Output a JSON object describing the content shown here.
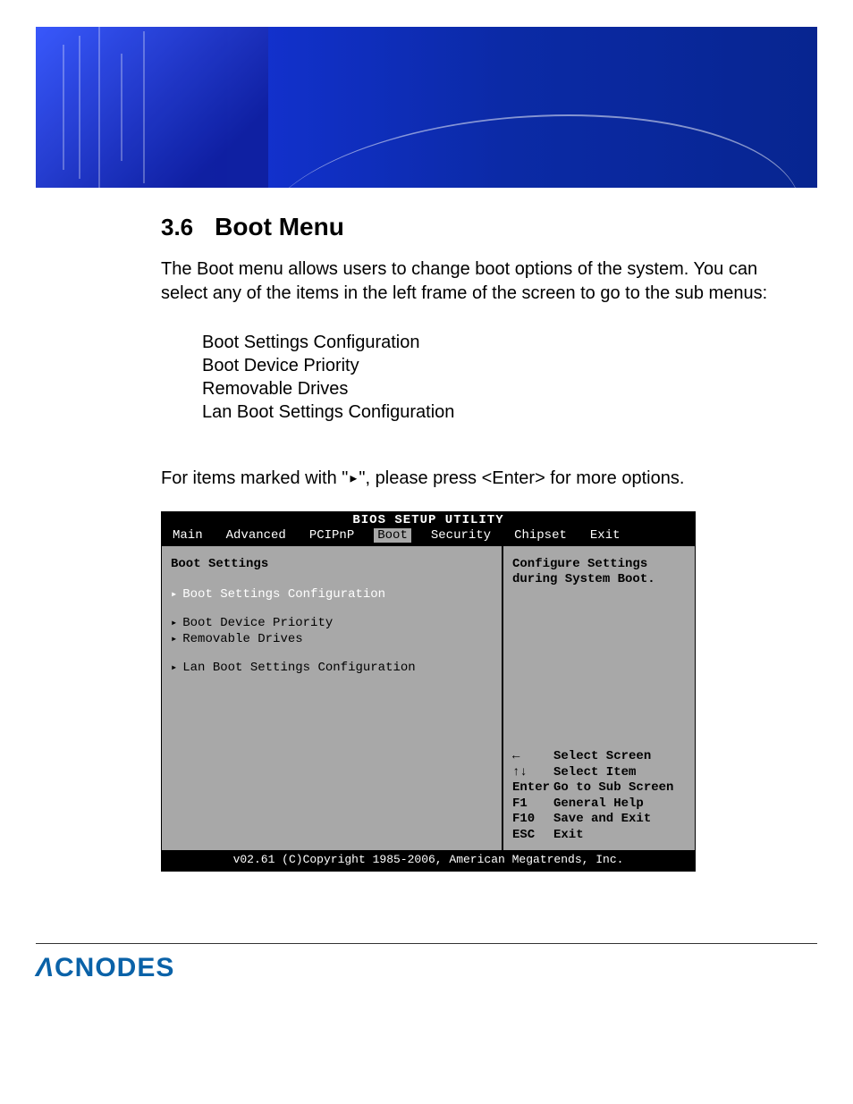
{
  "section": {
    "number": "3.6",
    "title": "Boot Menu"
  },
  "intro": "The Boot menu allows users to change boot options of the system. You can select any of the items in the left frame of the screen to go to the sub  menus:",
  "sub_items": [
    "Boot Settings Configuration",
    "Boot Device Priority",
    "Removable Drives",
    "Lan Boot Settings Configuration"
  ],
  "note_prefix": "For items marked with \"",
  "note_arrow": "▸",
  "note_suffix": "\",  please press <Enter> for more options.",
  "bios": {
    "title": "BIOS SETUP UTILITY",
    "tabs": [
      "Main",
      "Advanced",
      "PCIPnP",
      "Boot",
      "Security",
      "Chipset",
      "Exit"
    ],
    "active_tab": "Boot",
    "panel_title": "Boot Settings",
    "items": [
      {
        "label": "Boot Settings Configuration",
        "selected": true
      },
      {
        "label": "Boot Device Priority",
        "selected": false
      },
      {
        "label": "Removable Drives",
        "selected": false
      },
      {
        "label": "Lan Boot Settings Configuration",
        "selected": false
      }
    ],
    "help_lines": [
      "Configure Settings",
      "during System Boot."
    ],
    "keys": [
      {
        "k": "←",
        "d": "Select Screen"
      },
      {
        "k": "↑↓",
        "d": "Select Item"
      },
      {
        "k": "Enter",
        "d": "Go to Sub Screen"
      },
      {
        "k": "F1",
        "d": "General Help"
      },
      {
        "k": "F10",
        "d": "Save and Exit"
      },
      {
        "k": "ESC",
        "d": "Exit"
      }
    ],
    "footer": "v02.61 (C)Copyright 1985-2006, American Megatrends, Inc."
  },
  "brand": "ACNODES"
}
